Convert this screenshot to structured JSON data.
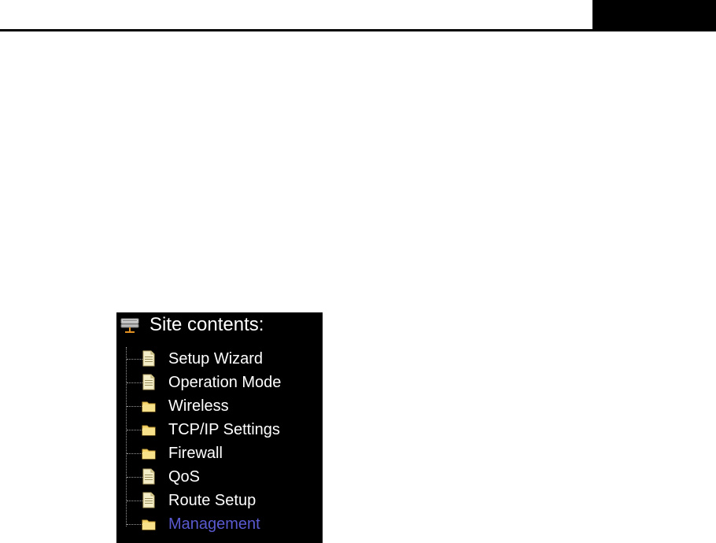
{
  "colors": {
    "panel_background": "#000000",
    "item_text": "#ffffff",
    "visited_item_text": "#5a5ad0",
    "folder_icon": "#f5d76e",
    "page_icon": "#f3eec8"
  },
  "site_contents": {
    "title": "Site contents:",
    "title_icon": "site-contents-icon",
    "items": [
      {
        "label": "Setup Wizard",
        "icon": "page-icon"
      },
      {
        "label": "Operation Mode",
        "icon": "page-icon"
      },
      {
        "label": "Wireless",
        "icon": "folder-icon"
      },
      {
        "label": "TCP/IP Settings",
        "icon": "folder-icon"
      },
      {
        "label": "Firewall",
        "icon": "folder-icon"
      },
      {
        "label": "QoS",
        "icon": "page-icon"
      },
      {
        "label": "Route Setup",
        "icon": "page-icon"
      },
      {
        "label": "Management",
        "icon": "folder-icon",
        "visited": true
      }
    ]
  }
}
